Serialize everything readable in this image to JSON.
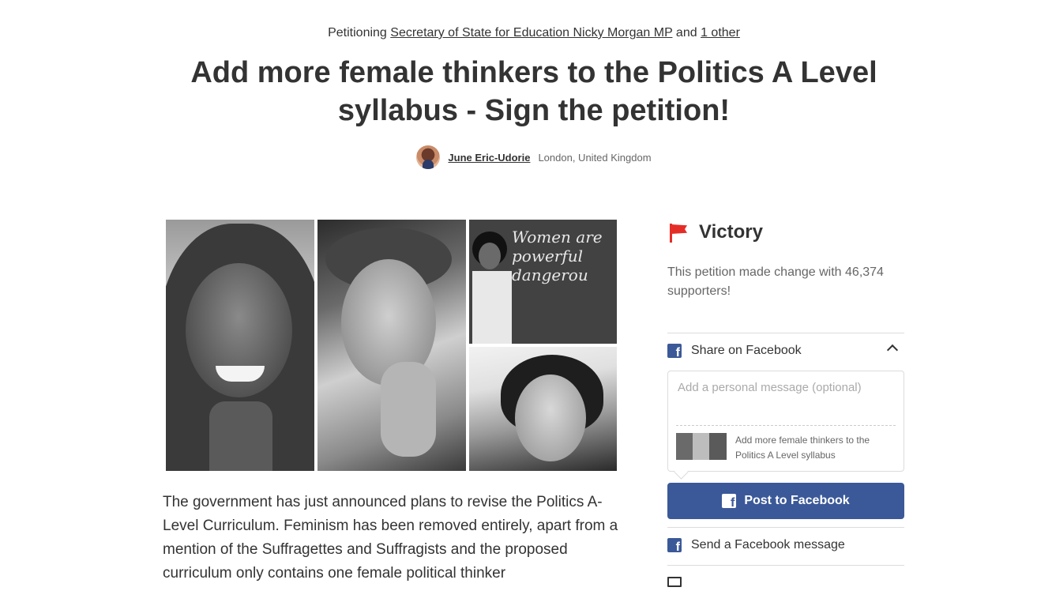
{
  "header": {
    "petitioning_prefix": "Petitioning",
    "target_primary": "Secretary of State for Education Nicky Morgan MP",
    "conjunction": "and",
    "target_other": "1 other",
    "title": "Add more female thinkers to the Politics A Level syllabus - Sign the petition!",
    "author_name": "June Eric-Udorie",
    "author_location": "London, United Kingdom"
  },
  "main": {
    "image_board_text": [
      "Women are",
      "powerful",
      "dangerou"
    ],
    "description": "The government has just announced plans to revise the Politics A-Level Curriculum. Feminism has been removed entirely, apart from a mention of the Suffragettes and Suffragists and the proposed curriculum only contains one female political thinker"
  },
  "sidebar": {
    "status_label": "Victory",
    "status_text": "This petition made change with 46,374 supporters!",
    "share_facebook_label": "Share on Facebook",
    "message_placeholder": "Add a personal message (optional)",
    "share_preview_text": "Add more female thinkers to the Politics A Level syllabus",
    "post_button_label": "Post to Facebook",
    "send_message_label": "Send a Facebook message",
    "colors": {
      "accent_red": "#e52d27",
      "facebook_blue": "#3b5998"
    }
  }
}
